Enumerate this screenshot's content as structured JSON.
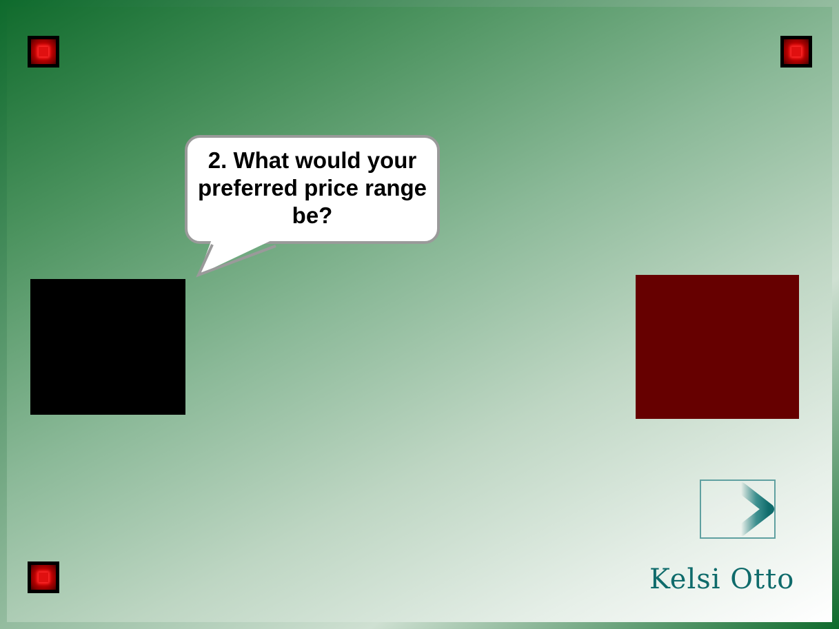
{
  "slide": {
    "question": "2. What would your preferred price range be?",
    "author": "Kelsi  Otto"
  },
  "icons": {
    "corner": "red-bevel-square-icon",
    "next": "teal-right-arrow-icon"
  },
  "colors": {
    "frame_green": "#0e6a2c",
    "corner_red": "#d40000",
    "left_block": "#000000",
    "right_block": "#660000",
    "bubble_border": "#9a9a9a",
    "author_teal": "#0f6b6b"
  }
}
